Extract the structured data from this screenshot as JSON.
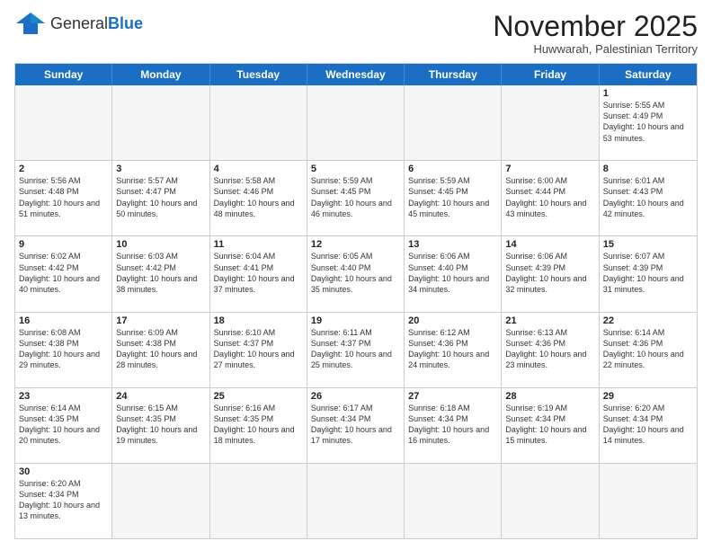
{
  "logo": {
    "text_general": "General",
    "text_blue": "Blue"
  },
  "title": "November 2025",
  "subtitle": "Huwwarah, Palestinian Territory",
  "weekdays": [
    "Sunday",
    "Monday",
    "Tuesday",
    "Wednesday",
    "Thursday",
    "Friday",
    "Saturday"
  ],
  "rows": [
    [
      {
        "day": "",
        "info": ""
      },
      {
        "day": "",
        "info": ""
      },
      {
        "day": "",
        "info": ""
      },
      {
        "day": "",
        "info": ""
      },
      {
        "day": "",
        "info": ""
      },
      {
        "day": "",
        "info": ""
      },
      {
        "day": "1",
        "info": "Sunrise: 5:55 AM\nSunset: 4:49 PM\nDaylight: 10 hours and 53 minutes."
      }
    ],
    [
      {
        "day": "2",
        "info": "Sunrise: 5:56 AM\nSunset: 4:48 PM\nDaylight: 10 hours and 51 minutes."
      },
      {
        "day": "3",
        "info": "Sunrise: 5:57 AM\nSunset: 4:47 PM\nDaylight: 10 hours and 50 minutes."
      },
      {
        "day": "4",
        "info": "Sunrise: 5:58 AM\nSunset: 4:46 PM\nDaylight: 10 hours and 48 minutes."
      },
      {
        "day": "5",
        "info": "Sunrise: 5:59 AM\nSunset: 4:45 PM\nDaylight: 10 hours and 46 minutes."
      },
      {
        "day": "6",
        "info": "Sunrise: 5:59 AM\nSunset: 4:45 PM\nDaylight: 10 hours and 45 minutes."
      },
      {
        "day": "7",
        "info": "Sunrise: 6:00 AM\nSunset: 4:44 PM\nDaylight: 10 hours and 43 minutes."
      },
      {
        "day": "8",
        "info": "Sunrise: 6:01 AM\nSunset: 4:43 PM\nDaylight: 10 hours and 42 minutes."
      }
    ],
    [
      {
        "day": "9",
        "info": "Sunrise: 6:02 AM\nSunset: 4:42 PM\nDaylight: 10 hours and 40 minutes."
      },
      {
        "day": "10",
        "info": "Sunrise: 6:03 AM\nSunset: 4:42 PM\nDaylight: 10 hours and 38 minutes."
      },
      {
        "day": "11",
        "info": "Sunrise: 6:04 AM\nSunset: 4:41 PM\nDaylight: 10 hours and 37 minutes."
      },
      {
        "day": "12",
        "info": "Sunrise: 6:05 AM\nSunset: 4:40 PM\nDaylight: 10 hours and 35 minutes."
      },
      {
        "day": "13",
        "info": "Sunrise: 6:06 AM\nSunset: 4:40 PM\nDaylight: 10 hours and 34 minutes."
      },
      {
        "day": "14",
        "info": "Sunrise: 6:06 AM\nSunset: 4:39 PM\nDaylight: 10 hours and 32 minutes."
      },
      {
        "day": "15",
        "info": "Sunrise: 6:07 AM\nSunset: 4:39 PM\nDaylight: 10 hours and 31 minutes."
      }
    ],
    [
      {
        "day": "16",
        "info": "Sunrise: 6:08 AM\nSunset: 4:38 PM\nDaylight: 10 hours and 29 minutes."
      },
      {
        "day": "17",
        "info": "Sunrise: 6:09 AM\nSunset: 4:38 PM\nDaylight: 10 hours and 28 minutes."
      },
      {
        "day": "18",
        "info": "Sunrise: 6:10 AM\nSunset: 4:37 PM\nDaylight: 10 hours and 27 minutes."
      },
      {
        "day": "19",
        "info": "Sunrise: 6:11 AM\nSunset: 4:37 PM\nDaylight: 10 hours and 25 minutes."
      },
      {
        "day": "20",
        "info": "Sunrise: 6:12 AM\nSunset: 4:36 PM\nDaylight: 10 hours and 24 minutes."
      },
      {
        "day": "21",
        "info": "Sunrise: 6:13 AM\nSunset: 4:36 PM\nDaylight: 10 hours and 23 minutes."
      },
      {
        "day": "22",
        "info": "Sunrise: 6:14 AM\nSunset: 4:36 PM\nDaylight: 10 hours and 22 minutes."
      }
    ],
    [
      {
        "day": "23",
        "info": "Sunrise: 6:14 AM\nSunset: 4:35 PM\nDaylight: 10 hours and 20 minutes."
      },
      {
        "day": "24",
        "info": "Sunrise: 6:15 AM\nSunset: 4:35 PM\nDaylight: 10 hours and 19 minutes."
      },
      {
        "day": "25",
        "info": "Sunrise: 6:16 AM\nSunset: 4:35 PM\nDaylight: 10 hours and 18 minutes."
      },
      {
        "day": "26",
        "info": "Sunrise: 6:17 AM\nSunset: 4:34 PM\nDaylight: 10 hours and 17 minutes."
      },
      {
        "day": "27",
        "info": "Sunrise: 6:18 AM\nSunset: 4:34 PM\nDaylight: 10 hours and 16 minutes."
      },
      {
        "day": "28",
        "info": "Sunrise: 6:19 AM\nSunset: 4:34 PM\nDaylight: 10 hours and 15 minutes."
      },
      {
        "day": "29",
        "info": "Sunrise: 6:20 AM\nSunset: 4:34 PM\nDaylight: 10 hours and 14 minutes."
      }
    ],
    [
      {
        "day": "30",
        "info": "Sunrise: 6:20 AM\nSunset: 4:34 PM\nDaylight: 10 hours and 13 minutes."
      },
      {
        "day": "",
        "info": ""
      },
      {
        "day": "",
        "info": ""
      },
      {
        "day": "",
        "info": ""
      },
      {
        "day": "",
        "info": ""
      },
      {
        "day": "",
        "info": ""
      },
      {
        "day": "",
        "info": ""
      }
    ]
  ]
}
